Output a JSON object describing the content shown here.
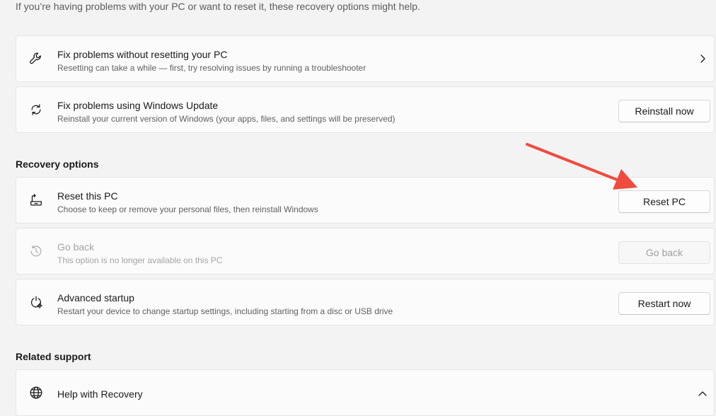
{
  "intro_text": "If you’re having problems with your PC or want to reset it, these recovery options might help.",
  "top_cards": [
    {
      "title": "Fix problems without resetting your PC",
      "desc": "Resetting can take a while — first, try resolving issues by running a troubleshooter"
    },
    {
      "title": "Fix problems using Windows Update",
      "desc": "Reinstall your current version of Windows (your apps, files, and settings will be preserved)",
      "button": "Reinstall now"
    }
  ],
  "recovery_options": {
    "heading": "Recovery options",
    "items": [
      {
        "title": "Reset this PC",
        "desc": "Choose to keep or remove your personal files, then reinstall Windows",
        "button": "Reset PC"
      },
      {
        "title": "Go back",
        "desc": "This option is no longer available on this PC",
        "button": "Go back",
        "disabled": true
      },
      {
        "title": "Advanced startup",
        "desc": "Restart your device to change startup settings, including starting from a disc or USB drive",
        "button": "Restart now"
      }
    ]
  },
  "related_support": {
    "heading": "Related support",
    "items": [
      {
        "title": "Help with Recovery"
      }
    ]
  },
  "colors": {
    "annotation_arrow": "#ef4b3f",
    "background": "#f3f3f3",
    "card": "#fbfbfb"
  },
  "icons": {
    "fix_without_reset": "wrench-icon",
    "windows_update": "sync-icon",
    "reset_pc": "reset-pc-icon",
    "go_back": "history-icon",
    "advanced_startup": "advanced-startup-icon",
    "help_recovery": "globe-icon"
  }
}
